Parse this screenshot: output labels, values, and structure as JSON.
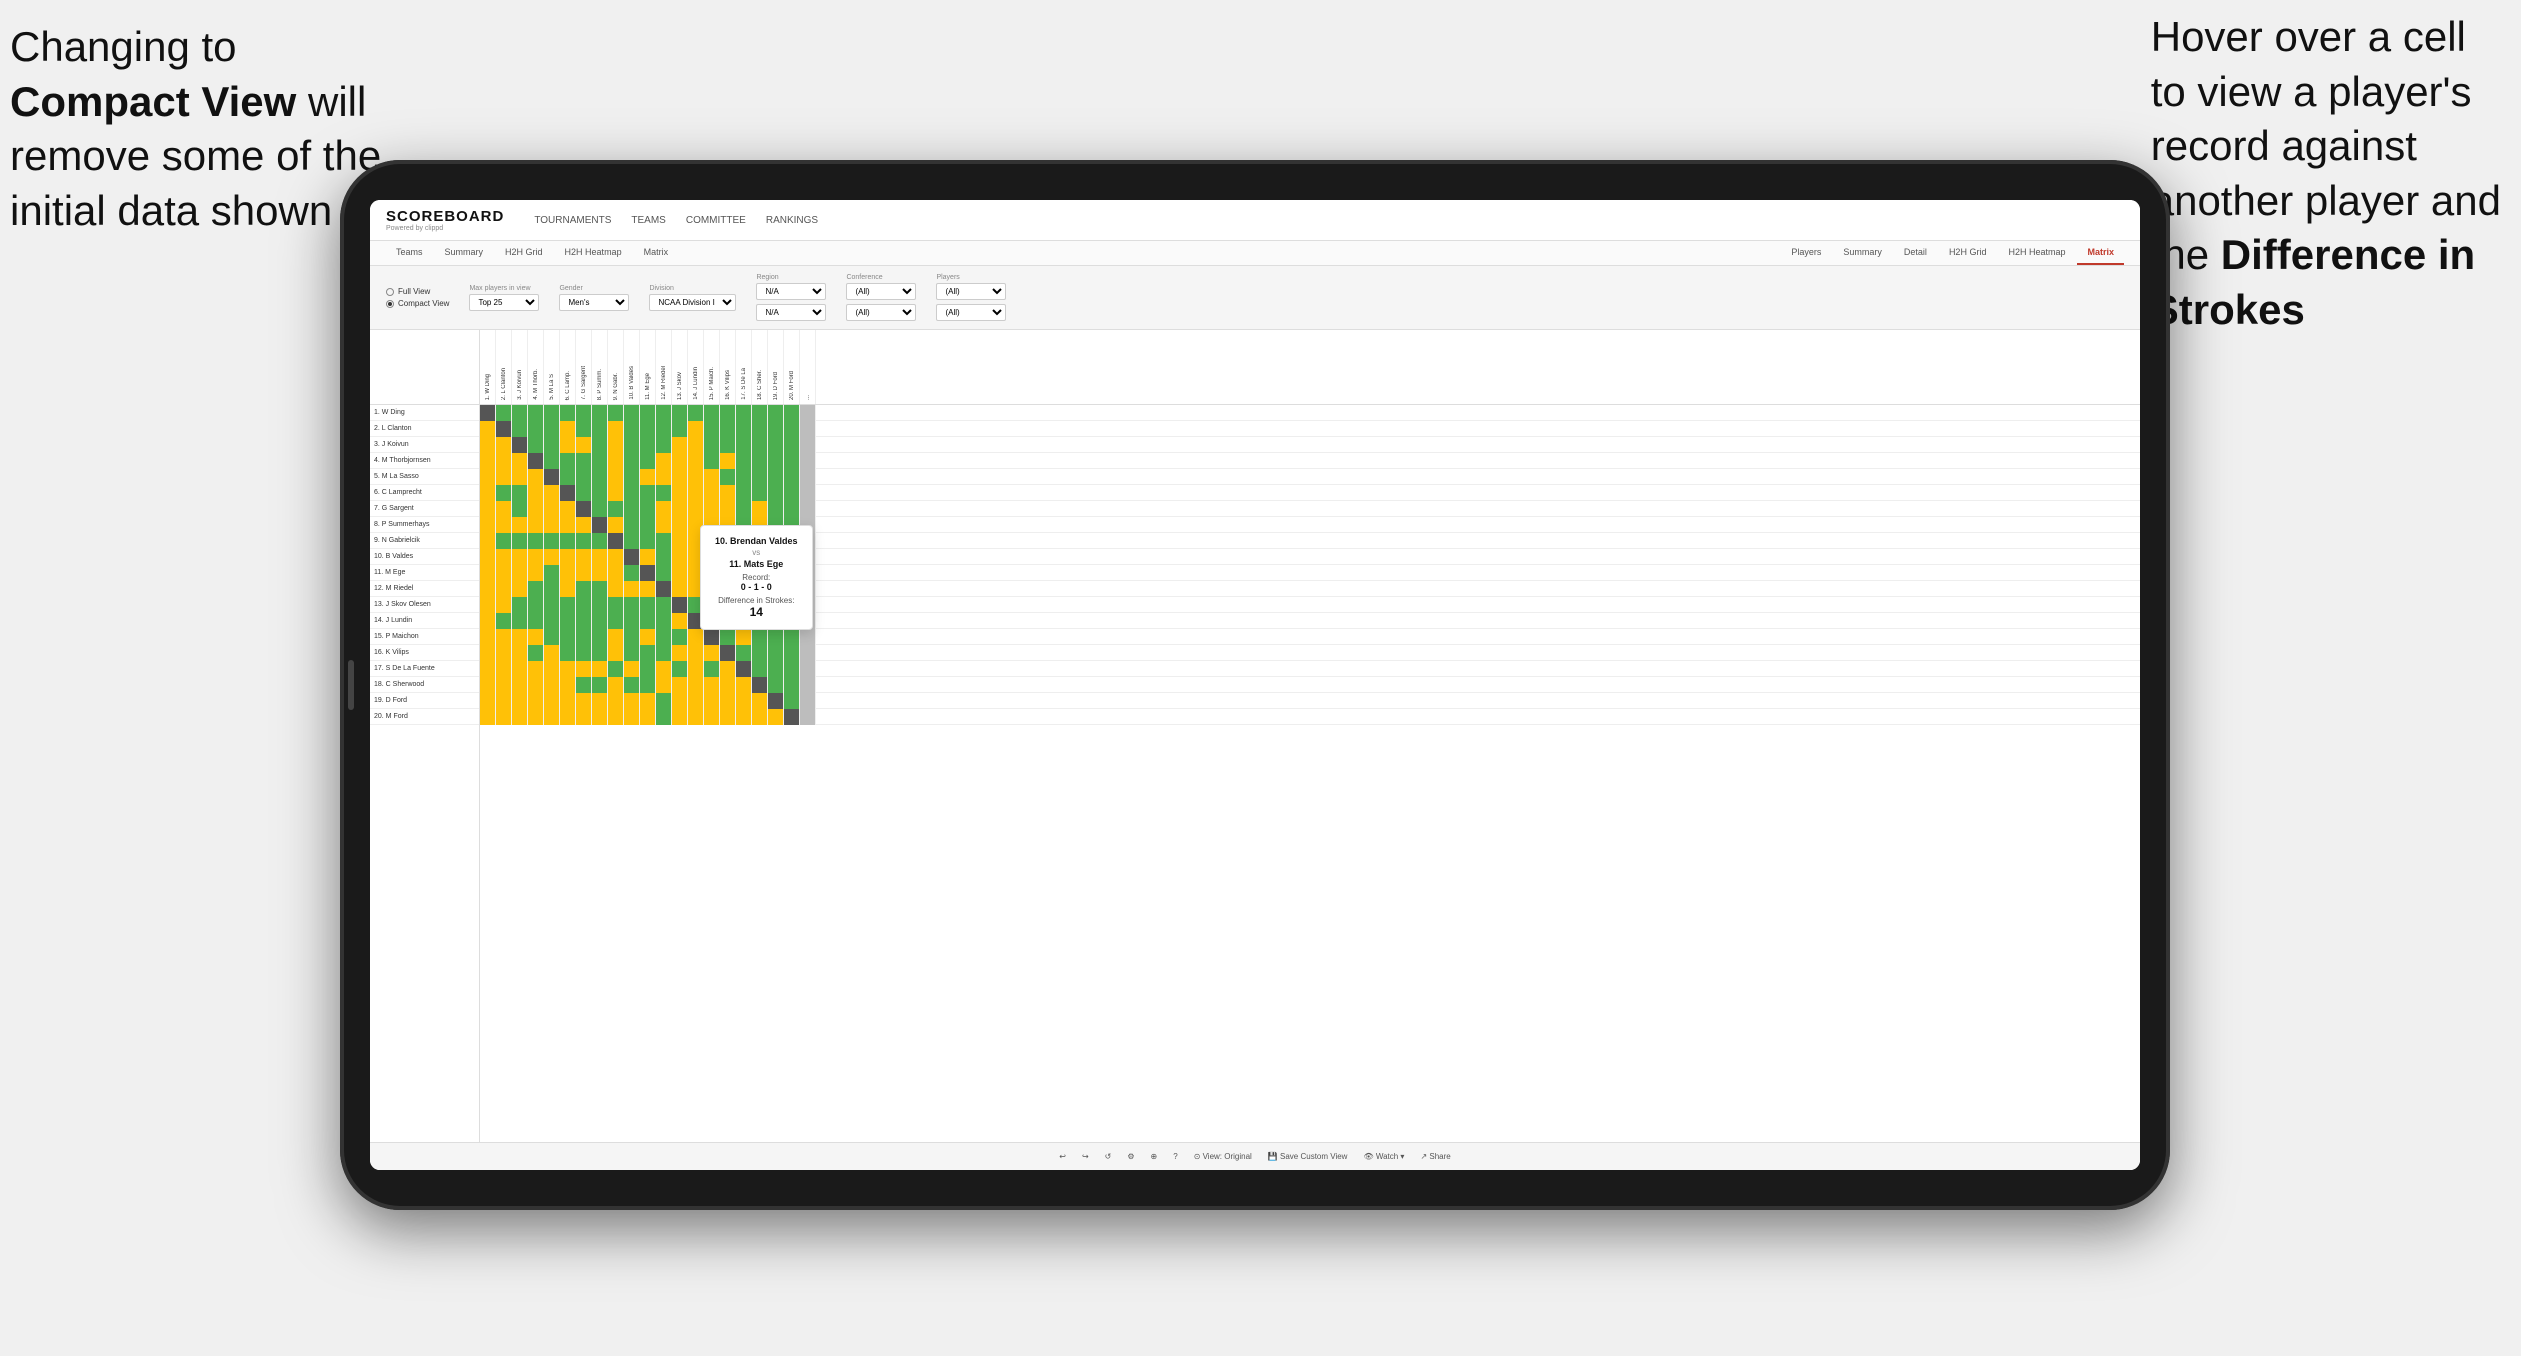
{
  "annotations": {
    "left_text_line1": "Changing to",
    "left_text_bold": "Compact View",
    "left_text_line2": " will",
    "left_text_line3": "remove some of the",
    "left_text_line4": "initial data shown",
    "right_text_line1": "Hover over a cell",
    "right_text_line2": "to view a player's",
    "right_text_line3": "record against",
    "right_text_line4": "another player and",
    "right_text_line5": "the ",
    "right_text_bold": "Difference in",
    "right_text_line6": "Strokes"
  },
  "app": {
    "logo": "SCOREBOARD",
    "logo_sub": "Powered by clippd",
    "nav": [
      "TOURNAMENTS",
      "TEAMS",
      "COMMITTEE",
      "RANKINGS"
    ],
    "tabs_row1": [
      "Teams",
      "Summary",
      "H2H Grid",
      "H2H Heatmap",
      "Matrix"
    ],
    "tabs_row2": [
      "Players",
      "Summary",
      "Detail",
      "H2H Grid",
      "H2H Heatmap",
      "Matrix"
    ],
    "active_tab": "Matrix"
  },
  "controls": {
    "view_full": "Full View",
    "view_compact": "Compact View",
    "selected_view": "compact",
    "filters": [
      {
        "label": "Max players in view",
        "value": "Top 25"
      },
      {
        "label": "Gender",
        "value": "Men's"
      },
      {
        "label": "Division",
        "value": "NCAA Division I"
      },
      {
        "label": "Region",
        "value": "N/A"
      },
      {
        "label": "Conference",
        "value": "(All)"
      },
      {
        "label": "Players",
        "value": "(All)"
      }
    ]
  },
  "players": [
    "1. W Ding",
    "2. L Clanton",
    "3. J Koivun",
    "4. M Thorbjornsen",
    "5. M La Sasso",
    "6. C Lamprecht",
    "7. G Sargent",
    "8. P Summerhays",
    "9. N Gabrielcik",
    "10. B Valdes",
    "11. M Ege",
    "12. M Riedel",
    "13. J Skov Olesen",
    "14. J Lundin",
    "15. P Maichon",
    "16. K Vilips",
    "17. S De La Fuente",
    "18. C Sherwood",
    "19. D Ford",
    "20. M Ford"
  ],
  "col_headers": [
    "1. W Ding",
    "2. L Clanton",
    "3. J Koivun",
    "4. M Thorb.",
    "5. M La S",
    "6. C Lamp.",
    "7. G Sargent",
    "8. P Summ.",
    "9. N Gabr.",
    "10. B Valdes",
    "11. M Ege",
    "12. M Riedel",
    "13. J Skov",
    "14. J Lundin",
    "15. P Maich.",
    "16. K Vilips",
    "17. S De La",
    "18. C Sher.",
    "19. D Ford",
    "20. M Ford",
    "..."
  ],
  "tooltip": {
    "player1": "10. Brendan Valdes",
    "vs": "vs",
    "player2": "11. Mats Ege",
    "record_label": "Record:",
    "record": "0 - 1 - 0",
    "diff_label": "Difference in Strokes:",
    "diff": "14"
  },
  "toolbar": {
    "undo": "↩",
    "view_original": "⊙ View: Original",
    "save_custom": "💾 Save Custom View",
    "watch": "👁 Watch ▾",
    "share": "↗ Share"
  }
}
